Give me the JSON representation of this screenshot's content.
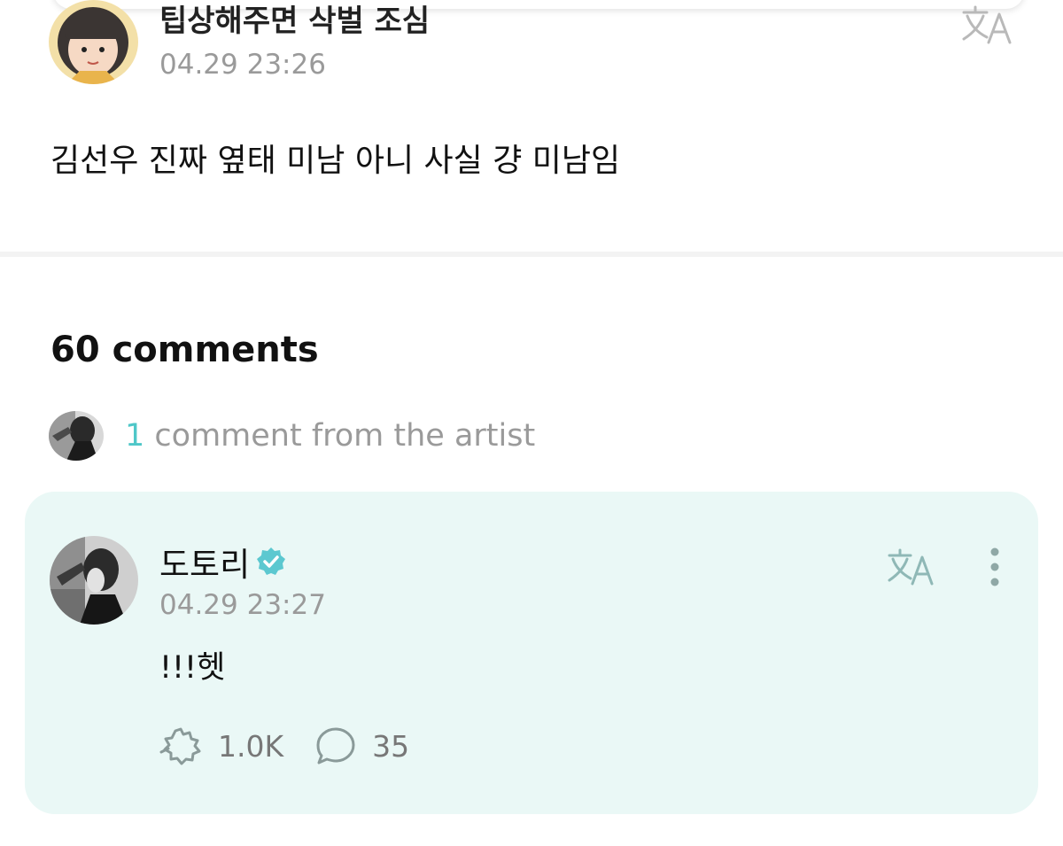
{
  "post": {
    "author_name": "팁상해주면 삭벌 조심",
    "time": "04.29 23:26",
    "body": "김선우 진짜 옆태 미남 아니 사실 걍 미남임"
  },
  "comments": {
    "count_label": "60 comments",
    "artist_summary_count": "1",
    "artist_summary_text": " comment from the artist"
  },
  "artist_comment": {
    "author_name": "도토리",
    "time": "04.29 23:27",
    "body": "!!!헷",
    "likes": "1.0K",
    "replies": "35"
  },
  "icons": {
    "translate": "translate-icon",
    "verified": "verified-badge-icon",
    "more": "more-vertical-icon",
    "like": "like-icon",
    "reply": "reply-bubble-icon"
  },
  "colors": {
    "accent": "#4fc7c8",
    "card_background": "#eaf8f6",
    "muted_text": "#9a9a9a"
  }
}
